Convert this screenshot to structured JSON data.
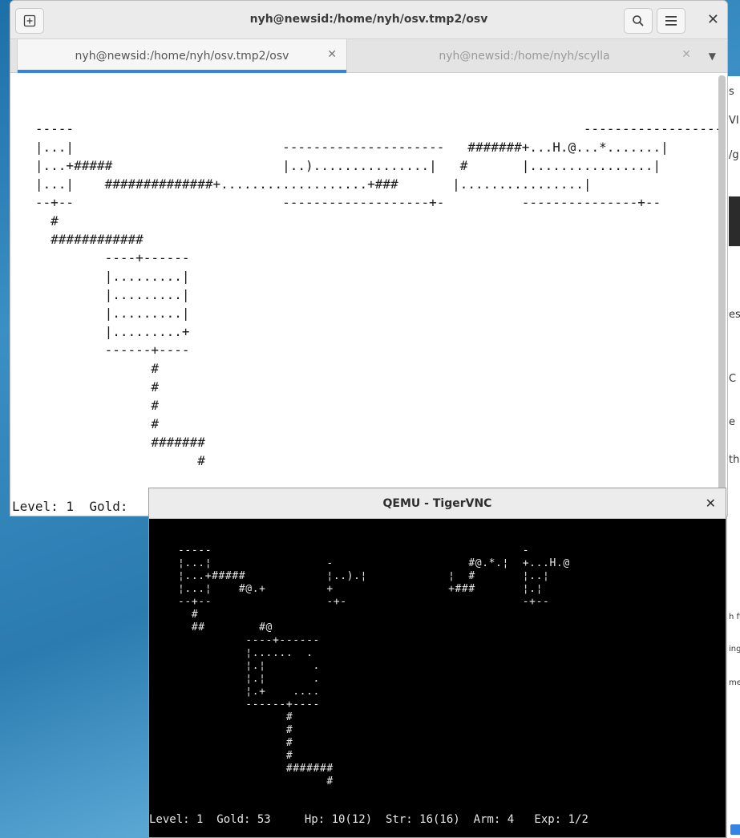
{
  "background_window": {
    "fragments": [
      "s",
      "VI",
      "/g",
      "es",
      "C d",
      "e",
      "the",
      "h fi",
      "ing",
      "men"
    ]
  },
  "terminal": {
    "title": "nyh@newsid:/home/nyh/osv.tmp2/osv",
    "tabs": [
      {
        "label": "nyh@newsid:/home/nyh/osv.tmp2/osv",
        "active": true
      },
      {
        "label": "nyh@newsid:/home/nyh/scylla",
        "active": false
      }
    ],
    "screen_lines": [
      "                                                                                      ",
      "   -----                                                                  ------------------",
      "   |...|                           ---------------------   #######+...H.@...*.......|",
      "   |...+#####                      |..)...............|   #       |................|",
      "   |...|    ##############+...................+###       |................|",
      "   --+--                           -------------------+-          ---------------+--",
      "     #",
      "     ############",
      "            ----+------",
      "            |.........|",
      "            |.........|",
      "            |.........|",
      "            |.........+",
      "            ------+----",
      "                  #",
      "                  #",
      "                  #",
      "                  #",
      "                  #######",
      "                        #"
    ],
    "status": "Level: 1  Gold: "
  },
  "vnc": {
    "title": "QEMU - TigerVNC",
    "screen_lines": [
      "-----                                              -",
      "¦...¦                 -                    #@.*.¦  +...H.@",
      "¦...+#####            ¦..).¦            ¦  #       ¦..¦",
      "¦...¦    #@.+         +                 +###       ¦.¦",
      "--+--                 -+-                          -+--",
      "  #",
      "  ##        #@",
      "          ----+------",
      "          ¦......  .",
      "          ¦.¦       .",
      "          ¦.¦       .",
      "          ¦.+    ....",
      "          ------+----",
      "                #",
      "                #",
      "                #",
      "                #",
      "                #######",
      "                      #"
    ],
    "status": "Level: 1  Gold: 53     Hp: 10(12)  Str: 16(16)  Arm: 4   Exp: 1/2"
  }
}
